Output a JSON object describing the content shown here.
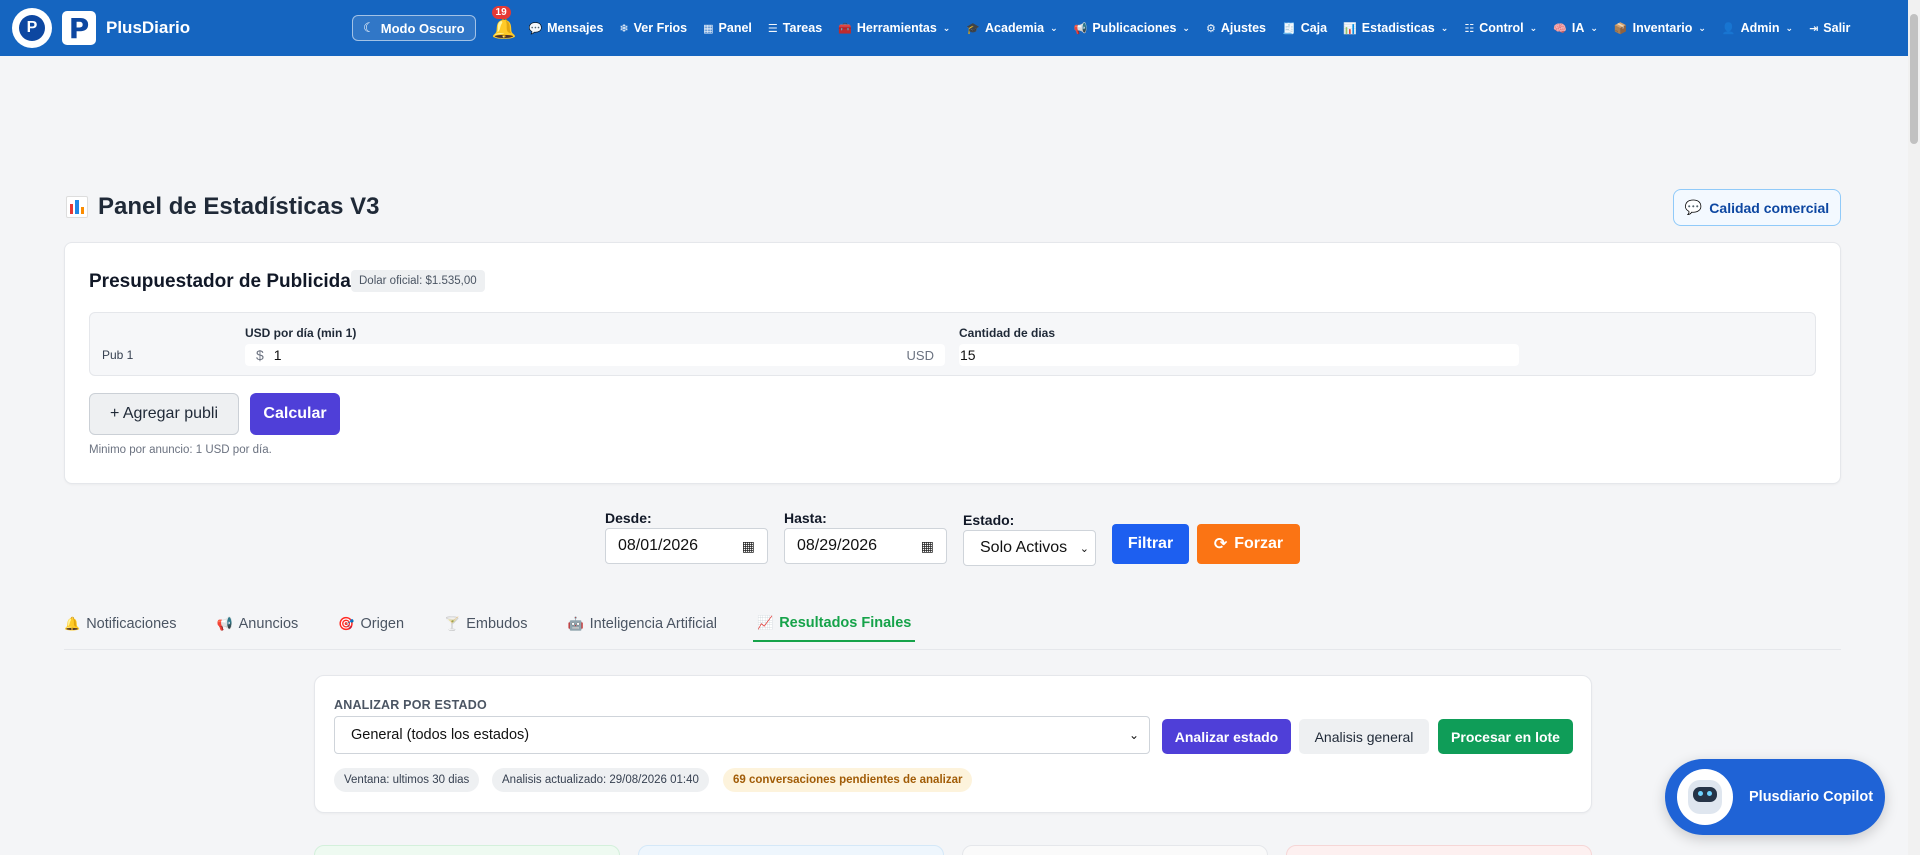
{
  "navbar": {
    "brand_initial": "P",
    "brand_logo_letter": "P",
    "brand_name": "PlusDiario",
    "dark_mode_label": "Modo Oscuro",
    "notification_count": "19",
    "items": [
      {
        "label": "Mensajes",
        "icon": "chat-icon",
        "glyph": "💬",
        "dropdown": false
      },
      {
        "label": "Ver Frios",
        "icon": "snowflake-icon",
        "glyph": "❄",
        "dropdown": false
      },
      {
        "label": "Panel",
        "icon": "panel-icon",
        "glyph": "▦",
        "dropdown": false
      },
      {
        "label": "Tareas",
        "icon": "tasks-icon",
        "glyph": "☰",
        "dropdown": false
      },
      {
        "label": "Herramientas",
        "icon": "toolbox-icon",
        "glyph": "🧰",
        "dropdown": true
      },
      {
        "label": "Academia",
        "icon": "graduation-cap-icon",
        "glyph": "🎓",
        "dropdown": true
      },
      {
        "label": "Publicaciones",
        "icon": "megaphone-icon",
        "glyph": "📢",
        "dropdown": true
      },
      {
        "label": "Ajustes",
        "icon": "gear-icon",
        "glyph": "⚙",
        "dropdown": false
      },
      {
        "label": "Caja",
        "icon": "cash-register-icon",
        "glyph": "🧾",
        "dropdown": false
      },
      {
        "label": "Estadisticas",
        "icon": "bar-chart-icon",
        "glyph": "📊",
        "dropdown": true
      },
      {
        "label": "Control",
        "icon": "sliders-icon",
        "glyph": "☷",
        "dropdown": true
      },
      {
        "label": "IA",
        "icon": "brain-icon",
        "glyph": "🧠",
        "dropdown": true
      },
      {
        "label": "Inventario",
        "icon": "boxes-icon",
        "glyph": "📦",
        "dropdown": true
      },
      {
        "label": "Admin",
        "icon": "user-gear-icon",
        "glyph": "👤",
        "dropdown": true
      },
      {
        "label": "Salir",
        "icon": "logout-icon",
        "glyph": "⇥",
        "dropdown": false
      }
    ]
  },
  "header": {
    "title": "Panel de Estadísticas V3",
    "calidad_button": "Calidad comercial"
  },
  "budget": {
    "title": "Presupuestador de Publicidad",
    "dolar_oficial": "Dolar oficial: $1.535,00",
    "row": {
      "label": "Pub 1",
      "usd_label": "USD por día (min 1)",
      "currency_symbol": "$",
      "usd_value": "1",
      "usd_unit": "USD",
      "dias_label": "Cantidad de dias",
      "dias_value": "15"
    },
    "add_button": "+ Agregar publi",
    "calc_button": "Calcular",
    "minimo_note": "Minimo por anuncio: 1 USD por día."
  },
  "filters": {
    "desde_label": "Desde:",
    "desde_value": "08/01/2026",
    "hasta_label": "Hasta:",
    "hasta_value": "08/29/2026",
    "estado_label": "Estado:",
    "estado_value": "Solo Activos",
    "filtrar_button": "Filtrar",
    "forzar_button": "Forzar"
  },
  "tabs": [
    {
      "label": "Notificaciones",
      "icon": "bell-icon",
      "glyph": "🔔",
      "active": false
    },
    {
      "label": "Anuncios",
      "icon": "megaphone-icon",
      "glyph": "📢",
      "active": false
    },
    {
      "label": "Origen",
      "icon": "target-icon",
      "glyph": "🎯",
      "active": false
    },
    {
      "label": "Embudos",
      "icon": "funnel-icon",
      "glyph": "🍸",
      "active": false
    },
    {
      "label": "Inteligencia Artificial",
      "icon": "robot-icon",
      "glyph": "🤖",
      "active": false
    },
    {
      "label": "Resultados Finales",
      "icon": "trend-chart-icon",
      "glyph": "📈",
      "active": true
    }
  ],
  "analyze": {
    "label": "ANALIZAR POR ESTADO",
    "select_value": "General (todos los estados)",
    "analizar_button": "Analizar estado",
    "general_button": "Analisis general",
    "lote_button": "Procesar en lote",
    "ventana": "Ventana: ultimos 30 dias",
    "actualizado": "Analisis actualizado: 29/08/2026 01:40",
    "pendientes": "69 conversaciones pendientes de analizar"
  },
  "copilot": {
    "label": "Plusdiario Copilot"
  },
  "colors": {
    "navbar": "#1565c0",
    "primary_purple": "#4f3fd8",
    "filter_blue": "#1d5ff0",
    "forzar_orange": "#fb7414",
    "lote_green": "#0f9d58",
    "active_tab_green": "#16a34a"
  }
}
